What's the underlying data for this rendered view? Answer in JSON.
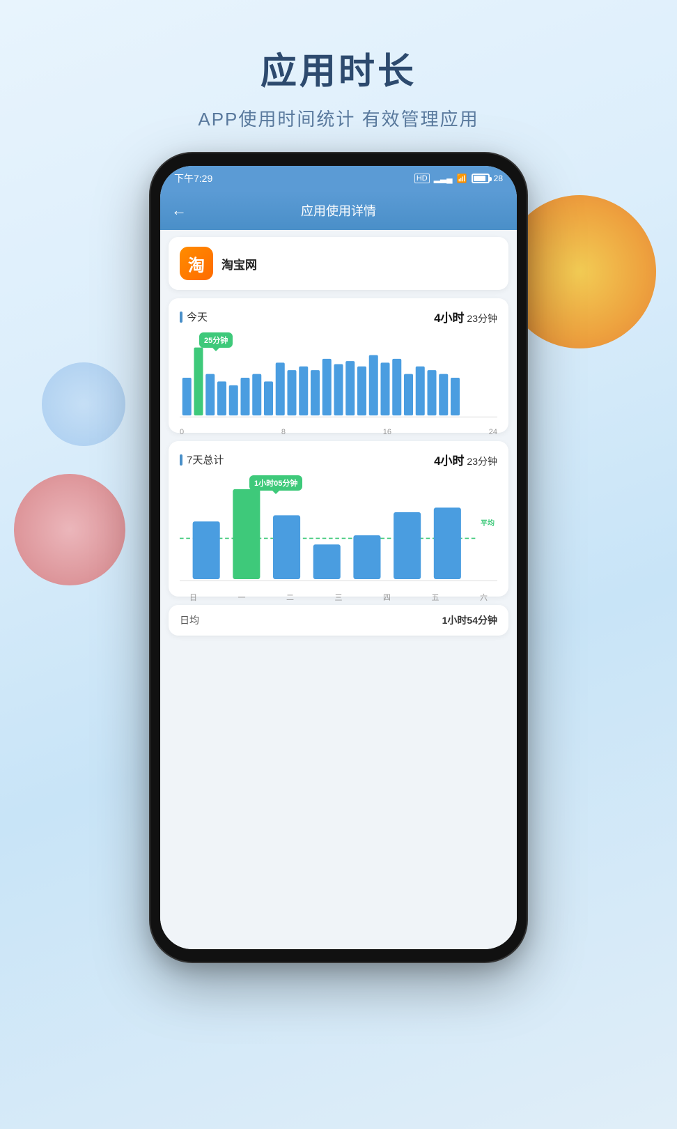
{
  "page": {
    "background": "#dceefb",
    "title": "应用时长",
    "subtitle": "APP使用时间统计 有效管理应用"
  },
  "phone": {
    "status_bar": {
      "time": "下午7:29",
      "battery": "28"
    },
    "nav": {
      "back_label": "←",
      "title": "应用使用详情"
    },
    "app_info": {
      "icon_text": "淘",
      "name": "淘宝网"
    },
    "today_section": {
      "label": "今天",
      "time_display": "4小时",
      "time_minutes": "23分钟",
      "tooltip": "25分钟",
      "x_labels": [
        "0",
        "8",
        "16",
        "24"
      ]
    },
    "week_section": {
      "label": "7天总计",
      "time_display": "4小时",
      "time_minutes": "23分钟",
      "tooltip": "1小时05分钟",
      "avg_label": "平均",
      "x_labels": [
        "日",
        "一",
        "二",
        "三",
        "四",
        "五",
        "六"
      ]
    },
    "daily_avg": {
      "label": "日均",
      "value": "1小时54分钟"
    }
  }
}
